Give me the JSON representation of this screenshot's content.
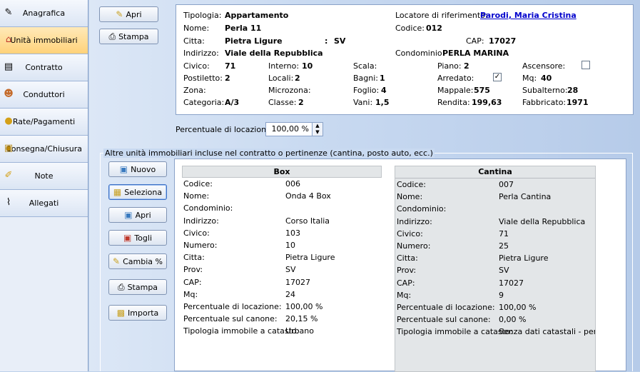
{
  "sidebar": [
    {
      "label": "Anagrafica",
      "icon": "pencil-icon"
    },
    {
      "label": "Unità immobiliari",
      "icon": "house-icon",
      "active": true
    },
    {
      "label": "Contratto",
      "icon": "document-icon"
    },
    {
      "label": "Conduttori",
      "icon": "person-icon"
    },
    {
      "label": "Rate/Pagamenti",
      "icon": "coins-icon"
    },
    {
      "label": "Consegna/Chiusura",
      "icon": "lock-icon"
    },
    {
      "label": "Note",
      "icon": "note-icon"
    },
    {
      "label": "Allegati",
      "icon": "paperclip-icon"
    }
  ],
  "top_buttons": {
    "apri": "Apri",
    "stampa": "Stampa"
  },
  "info": {
    "tipologia_l": "Tipologia:",
    "tipologia": "Appartamento",
    "nome_l": "Nome:",
    "nome": "Perla 11",
    "citta_l": "Citta:",
    "citta": "Pietra Ligure",
    "prov_sep": ":",
    "prov": "SV",
    "indirizzo_l": "Indirizzo:",
    "indirizzo": "Viale della Repubblica",
    "locatore_l": "Locatore di riferimento:",
    "locatore": "Parodi, Maria Cristina",
    "codice_l": "Codice:",
    "codice": "012",
    "cap_l": "CAP:",
    "cap": "17027",
    "condominio_l": "Condominio:",
    "condominio": "PERLA MARINA",
    "civico_l": "Civico:",
    "civico": "71",
    "interno_l": "Interno:",
    "interno": "10",
    "scala_l": "Scala:",
    "piano_l": "Piano:",
    "piano": "2",
    "ascensore_l": "Ascensore:",
    "ascensore": false,
    "postiletto_l": "Postiletto:",
    "postiletto": "2",
    "locali_l": "Locali:",
    "locali": "2",
    "bagni_l": "Bagni:",
    "bagni": "1",
    "arredato_l": "Arredato:",
    "arredato": true,
    "mq_l": "Mq:",
    "mq": "40",
    "zona_l": "Zona:",
    "microzona_l": "Microzona:",
    "foglio_l": "Foglio:",
    "foglio": "4",
    "mappale_l": "Mappale:",
    "mappale": "575",
    "subalterno_l": "Subalterno:",
    "subalterno": "28",
    "categoria_l": "Categoria:",
    "categoria": "A/3",
    "classe_l": "Classe:",
    "classe": "2",
    "vani_l": "Vani:",
    "vani": "1,5",
    "rendita_l": "Rendita:",
    "rendita": "199,63",
    "fabbricato_l": "Fabbricato:",
    "fabbricato": "1971"
  },
  "percentuale": {
    "label": "Percentuale di locazione",
    "value": "100,00 %"
  },
  "group_title": "Altre unità immobiliari incluse nel contratto o pertinenze (cantina, posto auto, ecc.)",
  "side_buttons": {
    "nuovo": "Nuovo",
    "seleziona": "Seleziona",
    "apri": "Apri",
    "togli": "Togli",
    "cambia": "Cambia %",
    "stampa": "Stampa",
    "importa": "Importa"
  },
  "units": [
    {
      "title": "Box",
      "rows": [
        {
          "k": "Codice:",
          "v": "006"
        },
        {
          "k": "Nome:",
          "v": "Onda 4 Box"
        },
        {
          "k": "Condominio:",
          "v": ""
        },
        {
          "k": "Indirizzo:",
          "v": "Corso Italia"
        },
        {
          "k": "Civico:",
          "v": "103"
        },
        {
          "k": "Numero:",
          "v": "10"
        },
        {
          "k": "Citta:",
          "v": "Pietra Ligure"
        },
        {
          "k": "Prov:",
          "v": "SV"
        },
        {
          "k": "CAP:",
          "v": "17027"
        },
        {
          "k": "Mq:",
          "v": "24"
        },
        {
          "k": "Percentuale di locazione:",
          "v": "100,00 %"
        },
        {
          "k": "Percentuale sul canone:",
          "v": "20,15 %"
        },
        {
          "k": "Tipologia immobile a catasto:",
          "v": "Urbano"
        }
      ]
    },
    {
      "title": "Cantina",
      "rows": [
        {
          "k": "Codice:",
          "v": "007"
        },
        {
          "k": "Nome:",
          "v": "Perla Cantina"
        },
        {
          "k": "Condominio:",
          "v": ""
        },
        {
          "k": "Indirizzo:",
          "v": "Viale della Repubblica"
        },
        {
          "k": "Civico:",
          "v": "71"
        },
        {
          "k": "Numero:",
          "v": "25"
        },
        {
          "k": "Citta:",
          "v": "Pietra Ligure"
        },
        {
          "k": "Prov:",
          "v": "SV"
        },
        {
          "k": "CAP:",
          "v": "17027"
        },
        {
          "k": "Mq:",
          "v": "9"
        },
        {
          "k": "Percentuale di locazione:",
          "v": "100,00 %"
        },
        {
          "k": "Percentuale sul canone:",
          "v": "0,00 %"
        },
        {
          "k": "Tipologia immobile a catasto:",
          "v": "Senza dati catastali - pertinenza"
        }
      ]
    }
  ]
}
